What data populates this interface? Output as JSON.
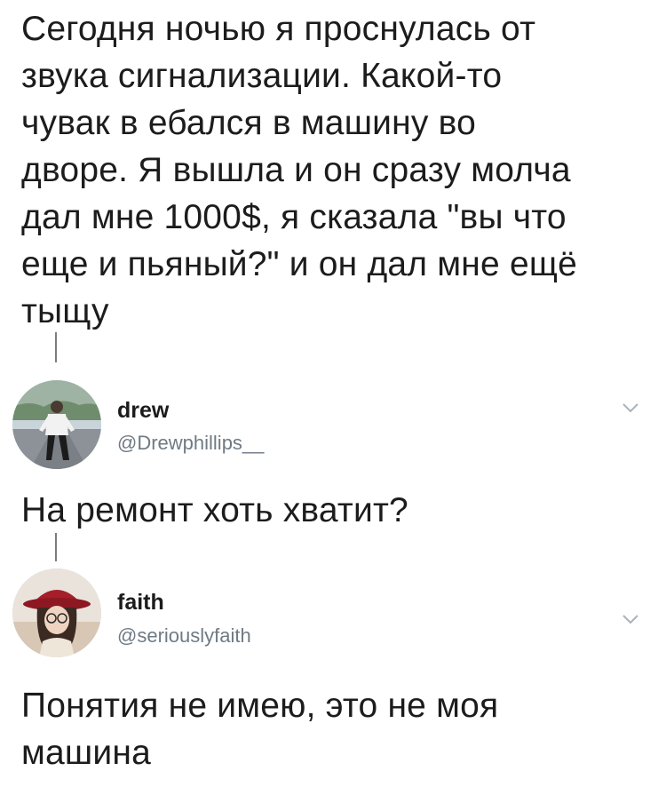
{
  "post": {
    "text": "Сегодня ночью я проснулась от\nзвука сигнализации. Какой-то\nчувак в ебался в машину во\nдворе. Я вышла и он сразу молча\nдал мне 1000$, я сказала \"вы что\nеще и пьяный?\" и он дал мне ещё\nтыщу"
  },
  "replies": [
    {
      "display_name": "drew",
      "handle": "@Drewphillips__",
      "text": "На ремонт хоть хватит?",
      "avatar_icon": "person-standing-avatar",
      "menu_icon": "chevron-down-icon"
    },
    {
      "display_name": "faith",
      "handle": "@seriouslyfaith",
      "text": "Понятия не имею, это не моя\nмашина",
      "avatar_icon": "person-red-hat-avatar",
      "menu_icon": "chevron-down-icon"
    }
  ],
  "colors": {
    "text": "#1c1c1c",
    "handle": "#6f7a84",
    "thread_line": "#7d7d7d",
    "chevron": "#aab3ba"
  }
}
